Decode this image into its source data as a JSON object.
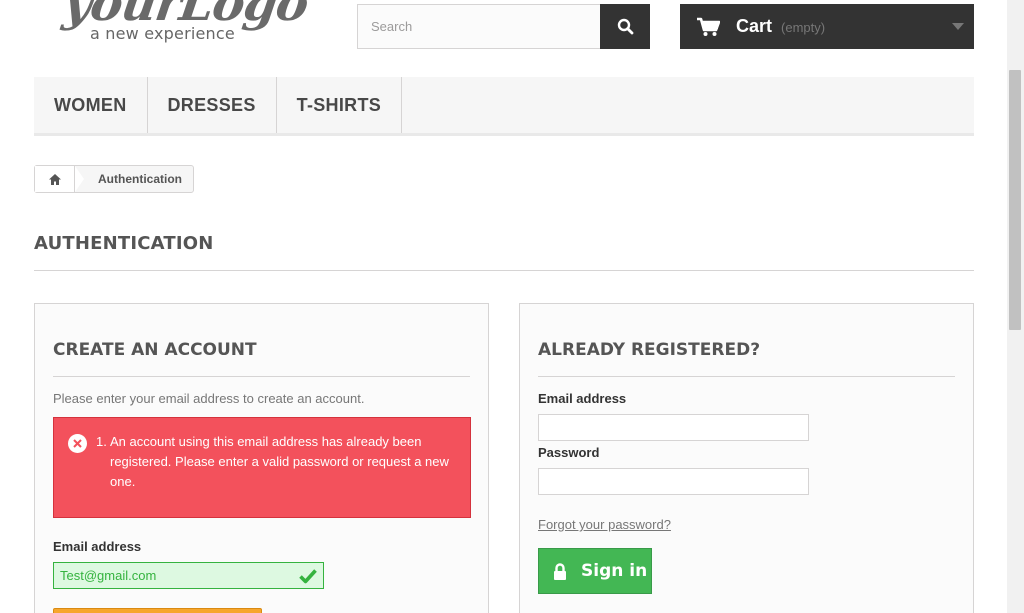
{
  "header": {
    "logo_text": "yourLogo",
    "logo_tagline": "a new experience",
    "search_placeholder": "Search",
    "cart_label": "Cart",
    "cart_status": "(empty)"
  },
  "nav": {
    "items": [
      "Women",
      "Dresses",
      "T-shirts"
    ]
  },
  "breadcrumb": {
    "current": "Authentication"
  },
  "page_title": "Authentication",
  "create_account": {
    "title": "Create an account",
    "intro": "Please enter your email address to create an account.",
    "error_number": "1.",
    "error_message": "An account using this email address has already been registered. Please enter a valid password or request a new one.",
    "email_label": "Email address",
    "email_value": "Test@gmail.com"
  },
  "already_registered": {
    "title": "Already registered?",
    "email_label": "Email address",
    "password_label": "Password",
    "forgot_link": "Forgot your password?",
    "sign_in_label": "Sign in"
  },
  "colors": {
    "error": "#f3515c",
    "success": "#43b754",
    "dark": "#333333",
    "accent_orange": "#f7a62d"
  }
}
